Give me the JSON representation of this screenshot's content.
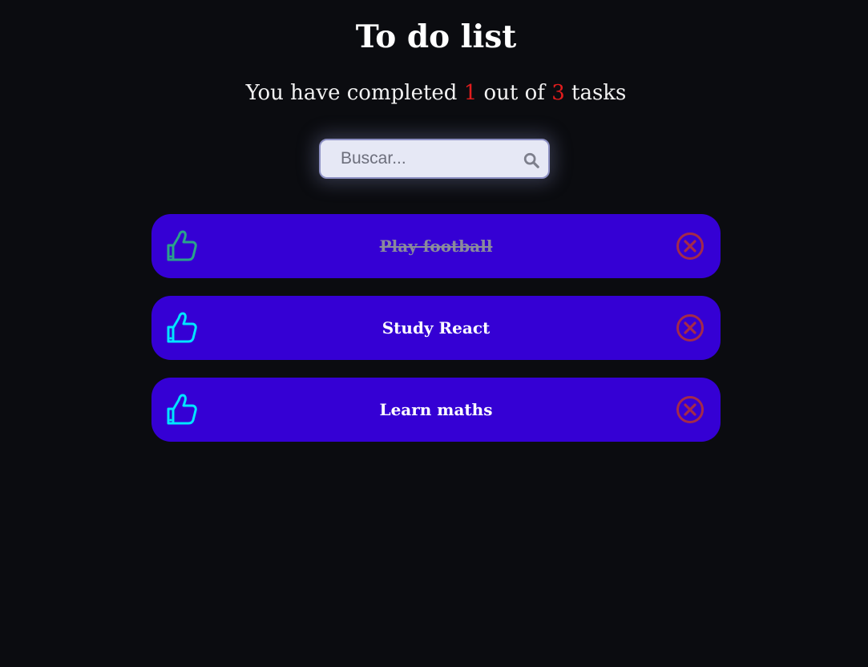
{
  "page": {
    "title": "To do list"
  },
  "counter": {
    "prefix": "You have completed ",
    "completed": "1",
    "middle": " out of ",
    "total": "3",
    "suffix": " tasks"
  },
  "search": {
    "placeholder": "Buscar...",
    "value": ""
  },
  "todos": [
    {
      "text": "Play football",
      "completed": true
    },
    {
      "text": "Study React",
      "completed": false
    },
    {
      "text": "Learn maths",
      "completed": false
    }
  ],
  "icons": {
    "check": "thumbs-up-icon",
    "delete": "close-circle-icon",
    "search": "search-icon"
  },
  "colors": {
    "background": "#0b0c10",
    "item_background": "#3500d4",
    "count_highlight": "#e21d1d",
    "check_active": "#00e5ff",
    "check_completed": "#2aa38a",
    "delete": "#a32a4a",
    "completed_text": "#8a8a9c"
  }
}
